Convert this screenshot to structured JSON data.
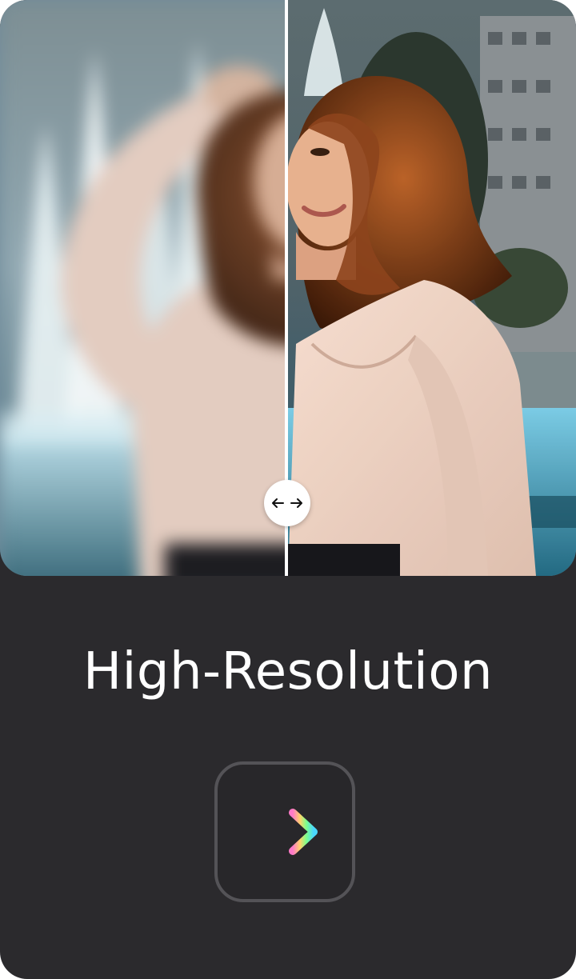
{
  "card": {
    "title": "High-Resolution"
  },
  "comparison": {
    "split_fraction": 0.5,
    "handle_icon": "left-right-arrow-icon",
    "handle_color": "#ffffff",
    "left_quality": "low-resolution-blurred",
    "right_quality": "high-resolution-sharp"
  },
  "button": {
    "icon": "right-arrow-icon",
    "gradient_colors": [
      "#ff7ac8",
      "#ffd36b",
      "#7dff8a",
      "#49d8ff"
    ]
  },
  "colors": {
    "background": "#2b2a2d",
    "text": "#ffffff",
    "button_border": "#545357"
  }
}
